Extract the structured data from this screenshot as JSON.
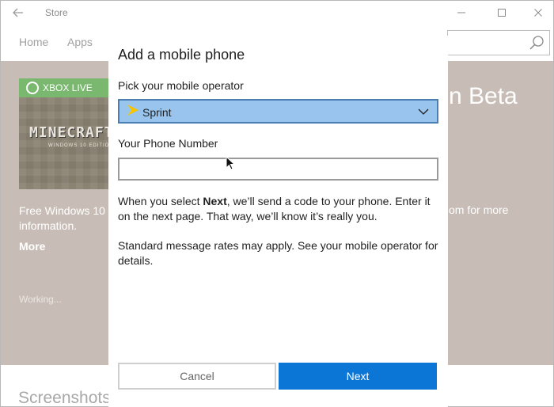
{
  "window": {
    "title": "Store",
    "controls": [
      "minimize-icon",
      "maximize-icon",
      "close-icon"
    ]
  },
  "nav": {
    "home": "Home",
    "apps": "Apps"
  },
  "hero": {
    "badge": "XBOX LIVE",
    "game_title": "MINECRAFT",
    "game_subtitle": "WINDOWS 10 EDITION BETA",
    "heading_tail": "n Beta",
    "description_left": "Free Windows 10 v",
    "description_left_2": "information.",
    "description_right": "om for more",
    "more_link": "More",
    "status": "Working..."
  },
  "section": {
    "screenshots": "Screenshots"
  },
  "dialog": {
    "title": "Add a mobile phone",
    "operator_label": "Pick your mobile operator",
    "operator_selected": "Sprint",
    "phone_label": "Your Phone Number",
    "phone_value": "",
    "info_pre": "When you select ",
    "info_bold": "Next",
    "info_post": ", we’ll send a code to your phone. Enter it on the next page. That way, we’ll know it’s really you.",
    "rates_note": "Standard message rates may apply. See your mobile operator for details.",
    "cancel_label": "Cancel",
    "next_label": "Next"
  },
  "colors": {
    "accent": "#0c76d7",
    "select_bg": "#99c4ed",
    "hero_bg": "#c8bdb6",
    "xbox_green": "#7bb86f",
    "sprint_yellow": "#f6c500"
  }
}
